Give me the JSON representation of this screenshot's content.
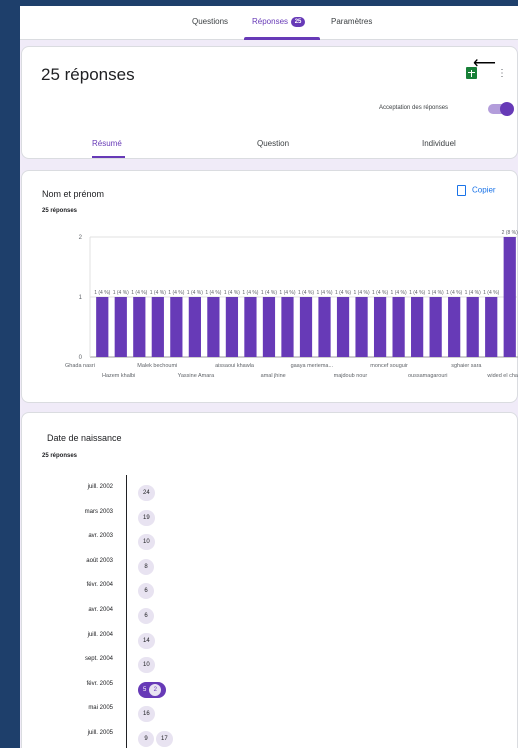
{
  "topbar": {
    "tabs": [
      {
        "label": "Questions"
      },
      {
        "label": "Réponses",
        "badge": "25"
      },
      {
        "label": "Paramètres"
      }
    ]
  },
  "summary_card": {
    "title": "25 réponses",
    "accept_label": "Acceptation des réponses",
    "accepting": true,
    "subtabs": [
      "Résumé",
      "Question",
      "Individuel"
    ],
    "icons": {
      "sheets": "sheets-icon",
      "more": "more-vert-icon",
      "arrow": "arrow-left-icon"
    }
  },
  "name_card": {
    "title": "Nom et prénom",
    "count": "25 réponses",
    "copy_label": "Copier"
  },
  "chart_data": {
    "type": "bar",
    "title": "Nom et prénom",
    "ylim": [
      0,
      2
    ],
    "yticks": [
      0,
      1,
      2
    ],
    "grid": true,
    "categories": [
      "Ghada nasri",
      "Hazem khalbi",
      "Malek bechoumi",
      "Yassine Amara",
      "aissaoui khawla",
      "amal jhine",
      "gaaya meriema...",
      "majdoub nour",
      "moncef souguir",
      "oussamagarouri",
      "sghaier sara",
      "wided el cha..."
    ],
    "bar_count": 23,
    "values": [
      1,
      1,
      1,
      1,
      1,
      1,
      1,
      1,
      1,
      1,
      1,
      1,
      1,
      1,
      1,
      1,
      1,
      1,
      1,
      1,
      1,
      1,
      2
    ],
    "data_labels": [
      "1 (4 %)",
      "1 (4 %)",
      "1 (4 %)",
      "1 (4 %)",
      "1 (4 %)",
      "1 (4 %)",
      "1 (4 %)",
      "1 (4 %)",
      "1 (4 %)",
      "1 (4 %)",
      "1 (4 %)",
      "1 (4 %)",
      "1 (4 %)",
      "1 (4 %)",
      "1 (4 %)",
      "1 (4 %)",
      "1 (4 %)",
      "1 (4 %)",
      "1 (4 %)",
      "1 (4 %)",
      "1 (4 %)",
      "1 (4 %)",
      "2 (8 %)"
    ],
    "color": "#673ab7"
  },
  "date_card": {
    "title": "Date de naissance",
    "count": "25 réponses",
    "rows": [
      {
        "label": "juill. 2002",
        "pills": [
          {
            "v": "24"
          }
        ]
      },
      {
        "label": "mars 2003",
        "pills": [
          {
            "v": "19"
          }
        ]
      },
      {
        "label": "avr. 2003",
        "pills": [
          {
            "v": "10"
          }
        ]
      },
      {
        "label": "août 2003",
        "pills": [
          {
            "v": "8"
          }
        ]
      },
      {
        "label": "févr. 2004",
        "pills": [
          {
            "v": "6"
          }
        ]
      },
      {
        "label": "avr. 2004",
        "pills": [
          {
            "v": "6"
          }
        ]
      },
      {
        "label": "juill. 2004",
        "pills": [
          {
            "v": "14"
          }
        ]
      },
      {
        "label": "sept. 2004",
        "pills": [
          {
            "v": "10"
          }
        ]
      },
      {
        "label": "févr. 2005",
        "pills": [
          {
            "v": "5",
            "dark": true,
            "count": "2"
          }
        ]
      },
      {
        "label": "mai 2005",
        "pills": [
          {
            "v": "16"
          }
        ]
      },
      {
        "label": "juill. 2005",
        "pills": [
          {
            "v": "9"
          },
          {
            "v": "17"
          }
        ]
      }
    ]
  }
}
